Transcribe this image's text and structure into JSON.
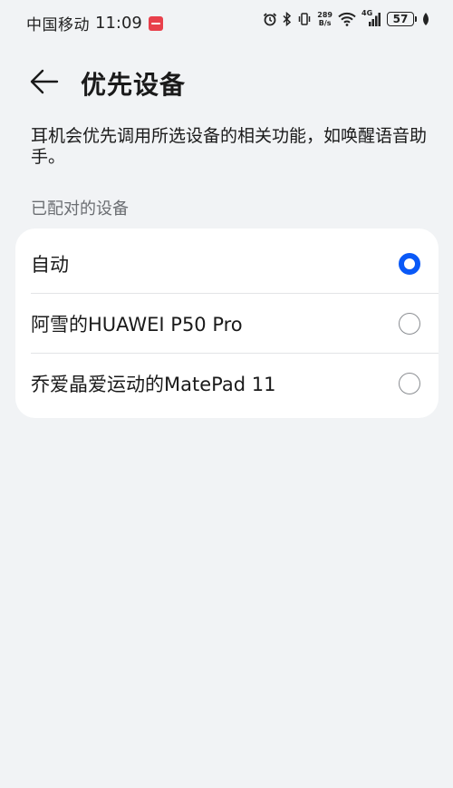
{
  "status_bar": {
    "carrier": "中国移动",
    "time": "11:09",
    "net_speed_value": "289",
    "net_speed_unit": "B/s",
    "network_type": "4G",
    "battery": "57"
  },
  "header": {
    "title": "优先设备"
  },
  "description": "耳机会优先调用所选设备的相关功能，如唤醒语音助手。",
  "section_label": "已配对的设备",
  "devices": [
    {
      "label": "自动",
      "selected": true
    },
    {
      "label": "阿雪的HUAWEI P50 Pro",
      "selected": false
    },
    {
      "label": "乔爱晶爱运动的MatePad 11",
      "selected": false
    }
  ],
  "colors": {
    "accent": "#0a59f7",
    "background": "#f1f3f5",
    "card": "#ffffff",
    "notification": "#e8404b"
  },
  "icons": {
    "back": "arrow-left-icon",
    "alarm": "alarm-icon",
    "bluetooth": "bluetooth-icon",
    "vibrate": "vibrate-icon",
    "wifi": "wifi-icon",
    "signal": "signal-icon",
    "battery": "battery-icon",
    "leaf": "leaf-icon"
  }
}
